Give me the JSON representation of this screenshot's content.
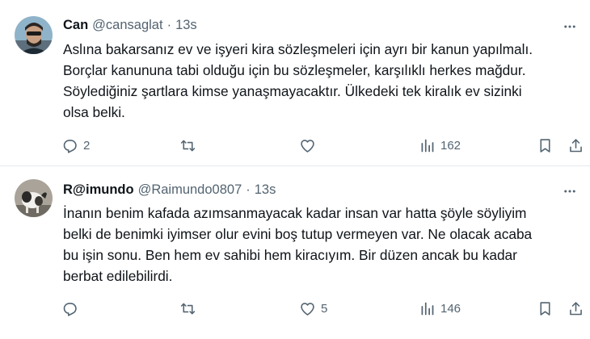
{
  "tweets": [
    {
      "name": "Can",
      "handle": "@cansaglat",
      "separator": "·",
      "time": "13s",
      "lines": [
        "Aslına bakarsanız ev ve işyeri kira sözleşmeleri için ayrı bir kanun yapılmalı.",
        "Borçlar kanununa tabi olduğu için bu sözleşmeler, karşılıklı herkes mağdur.",
        "Söylediğiniz şartlara kimse yanaşmayacaktır. Ülkedeki tek kiralık ev sizinki",
        "olsa belki."
      ],
      "replies": "2",
      "retweets": "",
      "likes": "",
      "views": "162"
    },
    {
      "name": "R@imundo",
      "handle": "@Raimundo0807",
      "separator": "·",
      "time": "13s",
      "lines": [
        "İnanın benim kafada azımsanmayacak kadar insan var hatta şöyle söyliyim",
        "belki de benimki iyimser olur evini boş tutup vermeyen var. Ne olacak acaba",
        "bu işin sonu. Ben hem ev sahibi hem kiracıyım. Bir düzen ancak bu kadar",
        "berbat edilebilirdi."
      ],
      "replies": "",
      "retweets": "",
      "likes": "5",
      "views": "146"
    }
  ],
  "icons": {
    "more": "more-horizontal-icon",
    "reply": "reply-icon",
    "retweet": "retweet-icon",
    "like": "heart-icon",
    "views": "views-chart-icon",
    "bookmark": "bookmark-icon",
    "share": "share-icon"
  },
  "colors": {
    "text": "#0f1419",
    "secondary": "#536471",
    "divider": "#e6e9ea"
  }
}
